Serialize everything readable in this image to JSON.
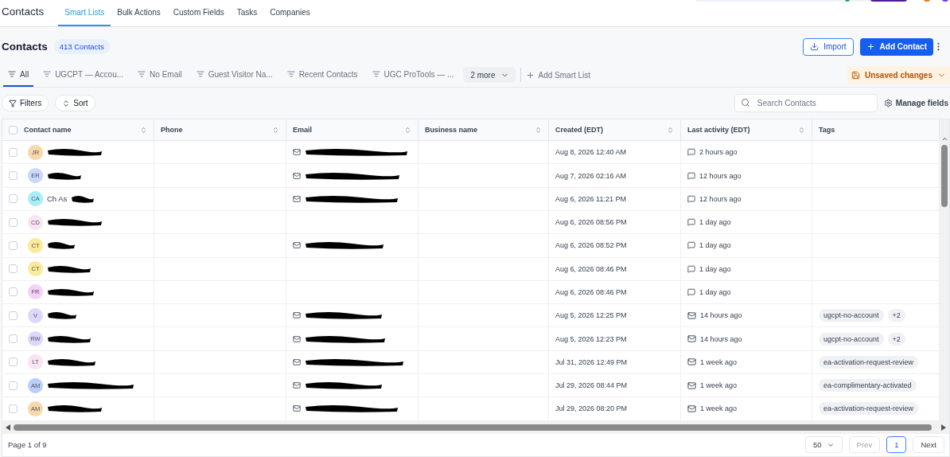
{
  "nav": {
    "title": "Contacts",
    "tabs": [
      {
        "label": "Smart Lists",
        "selected": true
      },
      {
        "label": "Bulk Actions",
        "selected": false
      },
      {
        "label": "Custom Fields",
        "selected": false
      },
      {
        "label": "Tasks",
        "selected": false
      },
      {
        "label": "Companies",
        "selected": false
      }
    ]
  },
  "header": {
    "title": "Contacts",
    "count": "413 Contacts",
    "import": "Import",
    "add": "Add Contact"
  },
  "smart_lists": {
    "items": [
      {
        "label": "All",
        "selected": true
      },
      {
        "label": "UGCPT — Accou...",
        "selected": false
      },
      {
        "label": "No Email",
        "selected": false
      },
      {
        "label": "Guest Visitor Na...",
        "selected": false
      },
      {
        "label": "Recent Contacts",
        "selected": false
      },
      {
        "label": "UGC ProTools — ...",
        "selected": false
      }
    ],
    "more": "2 more",
    "add": "Add Smart List",
    "unsaved": "Unsaved changes"
  },
  "toolbar": {
    "filters": "Filters",
    "sort": "Sort",
    "search_placeholder": "Search Contacts",
    "manage": "Manage fields"
  },
  "table": {
    "all_checked": false,
    "columns": [
      "Contact name",
      "Phone",
      "Email",
      "Business name",
      "Created (EDT)",
      "Last activity (EDT)",
      "Tags"
    ],
    "rows": [
      {
        "checked": false,
        "initials": "JR",
        "color": "#f8d8a8",
        "email": true,
        "created": "Aug 8, 2026 12:40 AM",
        "activity": {
          "kind": "chat",
          "text": "2 hours ago"
        },
        "tags": []
      },
      {
        "checked": false,
        "initials": "ER",
        "color": "#c9d8fb",
        "email": true,
        "created": "Aug 7, 2026 02:16 AM",
        "activity": {
          "kind": "chat",
          "text": "12 hours ago"
        },
        "tags": []
      },
      {
        "checked": false,
        "initials": "CA",
        "color": "#a8eef8",
        "name": "Ch As",
        "email": true,
        "created": "Aug 6, 2026 11:21 PM",
        "activity": {
          "kind": "chat",
          "text": "12 hours ago"
        },
        "tags": []
      },
      {
        "checked": false,
        "initials": "CD",
        "color": "#fae3f3",
        "email": false,
        "created": "Aug 6, 2026 08:56 PM",
        "activity": {
          "kind": "chat",
          "text": "1 day ago"
        },
        "tags": []
      },
      {
        "checked": false,
        "initials": "CT",
        "color": "#fcea9a",
        "email": true,
        "created": "Aug 6, 2026 08:52 PM",
        "activity": {
          "kind": "chat",
          "text": "1 day ago"
        },
        "tags": []
      },
      {
        "checked": false,
        "initials": "CT",
        "color": "#fcea9a",
        "email": false,
        "created": "Aug 6, 2026 08:46 PM",
        "activity": {
          "kind": "chat",
          "text": "1 day ago"
        },
        "tags": []
      },
      {
        "checked": false,
        "initials": "FR",
        "color": "#f5d0f7",
        "email": false,
        "created": "Aug 6, 2026 08:46 PM",
        "activity": {
          "kind": "chat",
          "text": "1 day ago"
        },
        "tags": []
      },
      {
        "checked": false,
        "initials": "V",
        "color": "#ddd8fb",
        "email": true,
        "created": "Aug 5, 2026 12:25 PM",
        "activity": {
          "kind": "email",
          "text": "14 hours ago"
        },
        "tags": [
          "ugcpt-no-account"
        ],
        "more_tags": "+2"
      },
      {
        "checked": false,
        "initials": "RW",
        "color": "#ddd8fb",
        "email": true,
        "created": "Aug 5, 2026 12:23 PM",
        "activity": {
          "kind": "email",
          "text": "14 hours ago"
        },
        "tags": [
          "ugcpt-no-account"
        ],
        "more_tags": "+2"
      },
      {
        "checked": false,
        "initials": "LT",
        "color": "#fae3f3",
        "email": true,
        "created": "Jul 31, 2026 12:49 PM",
        "activity": {
          "kind": "email",
          "text": "1 week ago"
        },
        "tags": [
          "ea-activation-request-review"
        ]
      },
      {
        "checked": false,
        "initials": "AM",
        "color": "#b9cffb",
        "email": true,
        "created": "Jul 29, 2026 08:44 PM",
        "activity": {
          "kind": "email",
          "text": "1 week ago"
        },
        "tags": [
          "ea-complimentary-activated"
        ]
      },
      {
        "checked": false,
        "initials": "AM",
        "color": "#f8d8a8",
        "email": true,
        "created": "Jul 29, 2026 08:20 PM",
        "activity": {
          "kind": "email",
          "text": "1 week ago"
        },
        "tags": [
          "ea-activation-request-review"
        ]
      }
    ]
  },
  "footer": {
    "page": "Page 1 of 9",
    "page_size": "50",
    "prev": "Prev",
    "current": "1",
    "next": "Next"
  }
}
